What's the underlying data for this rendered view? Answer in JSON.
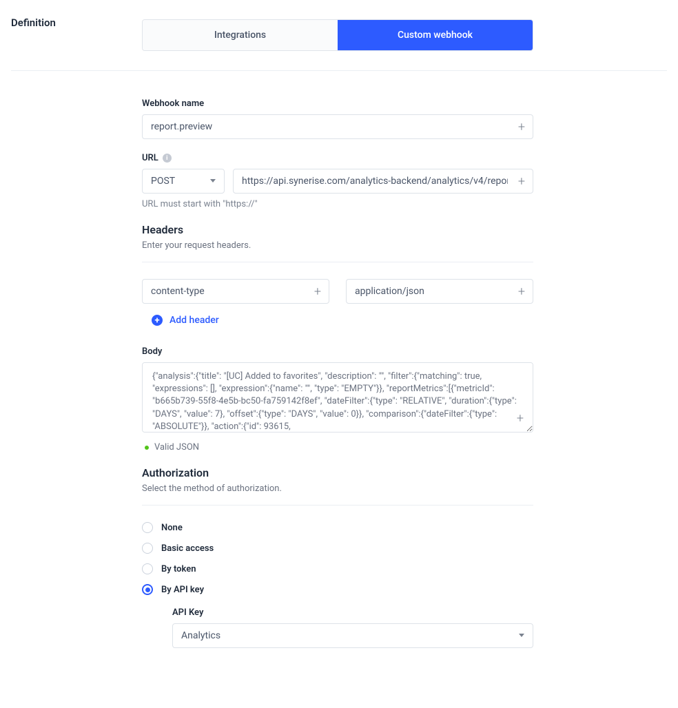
{
  "page": {
    "title": "Definition"
  },
  "tabs": {
    "integrations": "Integrations",
    "custom_webhook": "Custom webhook"
  },
  "webhook": {
    "name_label": "Webhook name",
    "name_value": "report.preview",
    "url_label": "URL",
    "method": "POST",
    "url_value": "https://api.synerise.com/analytics-backend/analytics/v4/repor",
    "url_helper": "URL must start with \"https://\""
  },
  "headers": {
    "title": "Headers",
    "subtitle": "Enter your request headers.",
    "key_value": "content-type",
    "val_value": "application/json",
    "add_label": "Add header"
  },
  "body": {
    "label": "Body",
    "value": "{\"analysis\":{\"title\": \"[UC] Added to favorites\", \"description\": \"\", \"filter\":{\"matching\": true, \"expressions\": [], \"expression\":{\"name\": \"\", \"type\": \"EMPTY\"}}, \"reportMetrics\":[{\"metricId\": \"b665b739-55f8-4e5b-bc50-fa759142f8ef\", \"dateFilter\":{\"type\": \"RELATIVE\", \"duration\":{\"type\": \"DAYS\", \"value\": 7}, \"offset\":{\"type\": \"DAYS\", \"value\": 0}}, \"comparison\":{\"dateFilter\":{\"type\": \"ABSOLUTE\"}}, \"action\":{\"id\": 93615,",
    "valid_label": "Valid JSON"
  },
  "auth": {
    "title": "Authorization",
    "subtitle": "Select the method of authorization.",
    "options": {
      "none": "None",
      "basic": "Basic access",
      "token": "By token",
      "api_key": "By API key"
    },
    "api_key_label": "API Key",
    "api_key_value": "Analytics"
  }
}
